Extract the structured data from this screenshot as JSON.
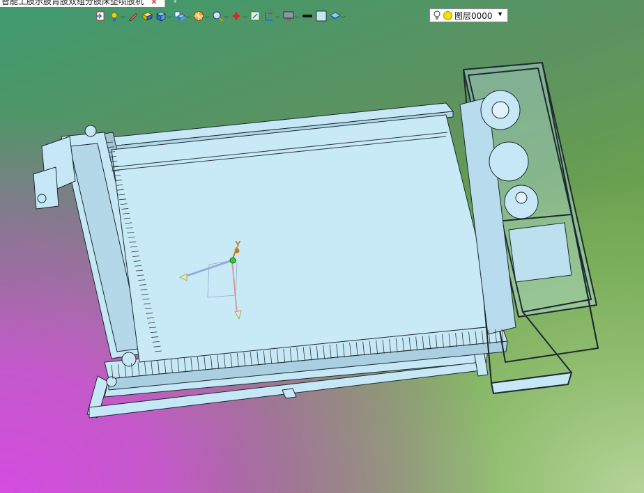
{
  "app": {
    "tab_title": "智能工肢示肢肯肢双组分肢床垫喷肢机",
    "tab_close": "×",
    "tab_add": "+"
  },
  "toolbar": {
    "items": [
      {
        "name": "exit-sketch-icon",
        "dropdown": false
      },
      {
        "name": "point-light-icon",
        "dropdown": true
      },
      {
        "name": "pen-icon",
        "dropdown": false
      },
      {
        "name": "solid-box-icon",
        "dropdown": false
      },
      {
        "name": "view-cube-icon",
        "dropdown": true
      },
      {
        "name": "display-style-icon",
        "dropdown": true
      },
      {
        "name": "section-view-icon",
        "dropdown": true
      },
      {
        "name": "zoom-icon",
        "dropdown": true
      },
      {
        "name": "triad-icon",
        "dropdown": true
      },
      {
        "name": "sketch-grid-icon",
        "dropdown": false
      },
      {
        "name": "dimension-icon",
        "dropdown": true
      },
      {
        "name": "monitor-icon",
        "dropdown": true
      },
      {
        "name": "line-color-icon",
        "dropdown": false
      },
      {
        "name": "fill-color-icon",
        "dropdown": false
      },
      {
        "name": "layers-icon",
        "dropdown": true
      }
    ],
    "layer_combo": {
      "value": "图层0000",
      "arrow": "▼"
    }
  },
  "triad": {
    "y_label": "Y"
  },
  "colors": {
    "part_fill": "#c6e8f6",
    "part_stroke": "#1c2a30",
    "accent_axis_y": "#c07a20",
    "accent_axis_x": "#8aa0d8",
    "accent_axis_z": "#d88a8a"
  }
}
